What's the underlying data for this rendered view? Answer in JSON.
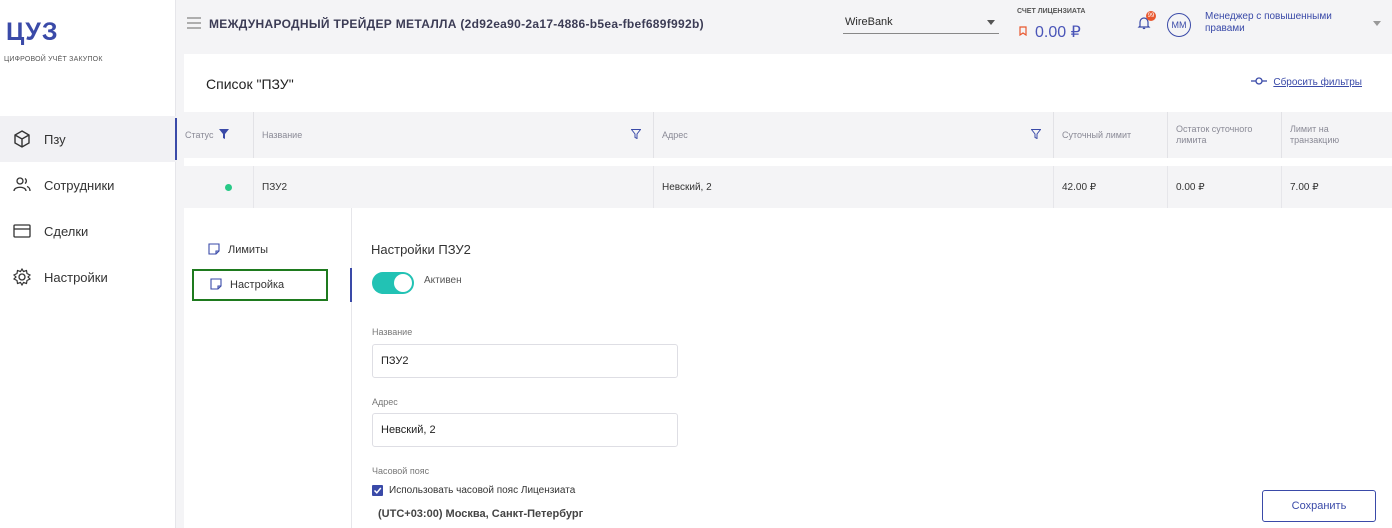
{
  "brand": {
    "logo": "ЦУЗ",
    "tagline": "ЦИФРОВОЙ УЧЁТ ЗАКУПОК"
  },
  "sidebar": {
    "items": [
      {
        "label": "Пзу",
        "icon": "cube-icon",
        "active": true
      },
      {
        "label": "Сотрудники",
        "icon": "users-icon",
        "active": false
      },
      {
        "label": "Сделки",
        "icon": "card-icon",
        "active": false
      },
      {
        "label": "Настройки",
        "icon": "gear-icon",
        "active": false
      }
    ]
  },
  "header": {
    "company": "МЕЖДУНАРОДНЫЙ ТРЕЙДЕР МЕТАЛЛА (2d92ea90-2a17-4886-b5ea-fbef689f992b)",
    "bank": "WireBank",
    "account_label": "СЧЕТ ЛИЦЕНЗИАТА",
    "account_value": "0.00 ₽",
    "notifications": "99",
    "avatar": "ММ",
    "user_role": "Менеджер с повышенными правами"
  },
  "page": {
    "title": "Список \"ПЗУ\"",
    "reset_filters": "Сбросить фильтры"
  },
  "table": {
    "columns": [
      "Статус",
      "Название",
      "Адрес",
      "Суточный лимит",
      "Остаток суточного лимита",
      "Лимит на транзакцию"
    ],
    "rows": [
      {
        "status": "active",
        "name": "ПЗУ2",
        "address": "Невский, 2",
        "daily_limit": "42.00 ₽",
        "daily_remaining": "0.00 ₽",
        "tx_limit": "7.00 ₽"
      }
    ]
  },
  "detail": {
    "tabs": [
      "Лимиты",
      "Настройка"
    ],
    "active_tab": "Настройка",
    "title": "Настройки ПЗУ2",
    "toggle_label": "Активен",
    "toggle_on": true,
    "name_label": "Название",
    "name_value": "ПЗУ2",
    "address_label": "Адрес",
    "address_value": "Невский, 2",
    "timezone_label": "Часовой пояс",
    "timezone_checkbox": "Использовать часовой пояс Лицензиата",
    "timezone_checked": true,
    "timezone_value": "(UTC+03:00) Москва, Санкт-Петербург",
    "save_label": "Сохранить"
  },
  "colors": {
    "accent": "#3a4aa8",
    "toggle": "#22c2b4",
    "status_active": "#28c987",
    "highlight": "#1e7a1e"
  }
}
